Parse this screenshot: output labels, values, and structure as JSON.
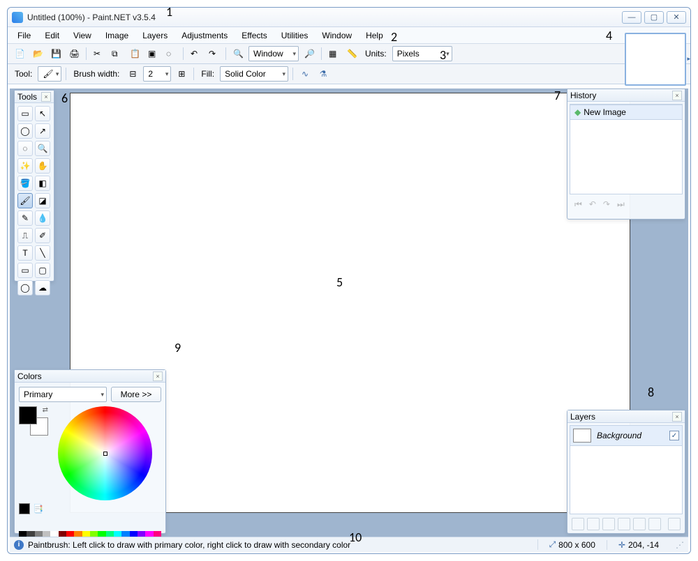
{
  "title": "Untitled (100%) - Paint.NET v3.5.4",
  "menu": [
    "File",
    "Edit",
    "View",
    "Image",
    "Layers",
    "Adjustments",
    "Effects",
    "Utilities",
    "Window",
    "Help"
  ],
  "toolbar": {
    "zoom_mode": "Window",
    "units_label": "Units:",
    "units_value": "Pixels",
    "tool_label": "Tool:",
    "brush_width_label": "Brush width:",
    "brush_width_value": "2",
    "fill_label": "Fill:",
    "fill_value": "Solid Color"
  },
  "panels": {
    "tools_title": "Tools",
    "history_title": "History",
    "history_item": "New Image",
    "layers_title": "Layers",
    "layer_name": "Background",
    "colors_title": "Colors",
    "color_mode": "Primary",
    "color_more": "More >>"
  },
  "status": {
    "hint": "Paintbrush: Left click to draw with primary color, right click to draw with secondary color",
    "size": "800 x 600",
    "coords": "204, -14"
  },
  "palette": [
    "#000000",
    "#404040",
    "#808080",
    "#c0c0c0",
    "#ffffff",
    "#800000",
    "#ff0000",
    "#ff8000",
    "#ffff00",
    "#80ff00",
    "#00ff00",
    "#00ff80",
    "#00ffff",
    "#0080ff",
    "#0000ff",
    "#8000ff",
    "#ff00ff",
    "#ff0080"
  ],
  "annotations": {
    "1": "1",
    "2": "2",
    "3": "3",
    "4": "4",
    "5": "5",
    "6": "6",
    "7": "7",
    "8": "8",
    "9": "9",
    "10": "10"
  }
}
